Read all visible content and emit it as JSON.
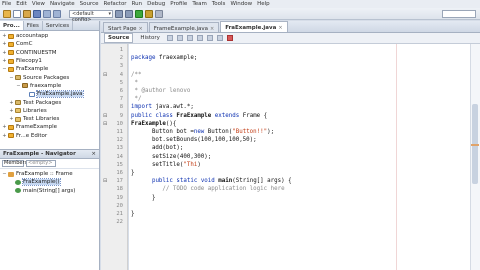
{
  "menu": [
    "File",
    "Edit",
    "View",
    "Navigate",
    "Source",
    "Refactor",
    "Run",
    "Debug",
    "Profile",
    "Team",
    "Tools",
    "Window",
    "Help"
  ],
  "toolbar": {
    "config": "<default config>"
  },
  "projects_panel": {
    "tabs": [
      "Pro...",
      "Files",
      "Services"
    ],
    "rows": [
      {
        "label": "accountapp",
        "type": "cup",
        "level": 0
      },
      {
        "label": "ComC",
        "type": "cup",
        "level": 0
      },
      {
        "label": "CONTINUESTM",
        "type": "cup",
        "level": 0
      },
      {
        "label": "Filecopy1",
        "type": "cup",
        "level": 0
      },
      {
        "label": "FraExample",
        "type": "cup",
        "level": 0,
        "expanded": true
      },
      {
        "label": "Source Packages",
        "type": "src",
        "level": 1,
        "expanded": true
      },
      {
        "label": "fraexample",
        "type": "pkg",
        "level": 2,
        "expanded": true
      },
      {
        "label": "FraExample.java",
        "type": "java",
        "level": 3,
        "selected": true
      },
      {
        "label": "Test Packages",
        "type": "src",
        "level": 1
      },
      {
        "label": "Libraries",
        "type": "lib",
        "level": 1
      },
      {
        "label": "Test Libraries",
        "type": "lib",
        "level": 1
      },
      {
        "label": "FrameExample",
        "type": "cup",
        "level": 0
      },
      {
        "label": "Fr...e Editor",
        "type": "cup",
        "level": 0
      }
    ]
  },
  "navigator": {
    "title": "FraExample - Navigator",
    "combo": "Members",
    "context": "<empty>",
    "rows": [
      {
        "label": "FraExample :: Frame",
        "level": 0
      },
      {
        "label": "FraExample()",
        "level": 1,
        "selected": true
      },
      {
        "label": "main(String[] args)",
        "level": 1
      }
    ]
  },
  "editor": {
    "tabs": [
      {
        "label": "Start Page",
        "active": false
      },
      {
        "label": "FrameExample.java",
        "active": false
      },
      {
        "label": "FraExample.java",
        "active": true
      }
    ],
    "subtabs": [
      "Source",
      "History"
    ],
    "current_line": 15,
    "lines": [
      {
        "n": 1,
        "html": ""
      },
      {
        "n": 2,
        "html": "<span class=\"kw\">package</span> fraexample;"
      },
      {
        "n": 3,
        "html": ""
      },
      {
        "n": 4,
        "html": "<span class=\"cm\">/**</span>"
      },
      {
        "n": 5,
        "html": "<span class=\"cm\"> *</span>"
      },
      {
        "n": 6,
        "html": "<span class=\"cm\"> * @author lenovo</span>"
      },
      {
        "n": 7,
        "html": "<span class=\"cm\"> */</span>"
      },
      {
        "n": 8,
        "html": "<span class=\"kw\">import</span> java.awt.*;"
      },
      {
        "n": 9,
        "html": "<span class=\"kw\">public class</span> <span class=\"fn\">FraExample</span> <span class=\"kw\">extends</span> Frame {"
      },
      {
        "n": 10,
        "html": "<span class=\"fn\">FraExample</span>(){"
      },
      {
        "n": 11,
        "html": "      Button bot =<span class=\"kw\">new</span> Button(<span class=\"st\">\"Button!!\"</span>);"
      },
      {
        "n": 12,
        "html": "      bot.setBounds(100,100,100,50);"
      },
      {
        "n": 13,
        "html": "      add(bot);"
      },
      {
        "n": 14,
        "html": "      setSize(400,300);"
      },
      {
        "n": 15,
        "html": "      setTitle(<span class=\"st\">\"Thi</span>)"
      },
      {
        "n": 16,
        "html": "}"
      },
      {
        "n": 17,
        "html": "      <span class=\"kw\">public static void</span> <span class=\"fn\">main</span>(String[] args) {"
      },
      {
        "n": 18,
        "html": "         <span class=\"cm\">// TODO code application logic here</span>"
      },
      {
        "n": 19,
        "html": "      }"
      },
      {
        "n": 20,
        "html": ""
      },
      {
        "n": 21,
        "html": "}"
      },
      {
        "n": 22,
        "html": ""
      }
    ]
  }
}
